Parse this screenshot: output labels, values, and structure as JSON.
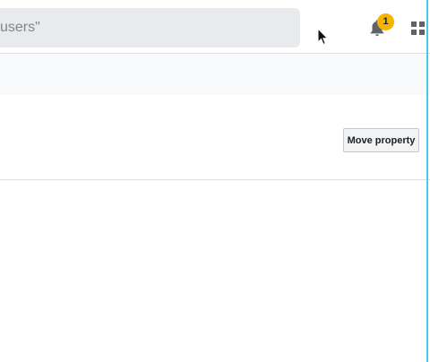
{
  "header": {
    "search_text": "users\"",
    "notification_count": "1",
    "bell_icon": "bell-icon",
    "apps_icon": "apps-grid-icon",
    "badge_color": "#f4b400"
  },
  "content": {
    "move_property_label": "Move property"
  },
  "colors": {
    "edge_accent": "#48c9e8",
    "search_bg": "#e8eaed"
  }
}
